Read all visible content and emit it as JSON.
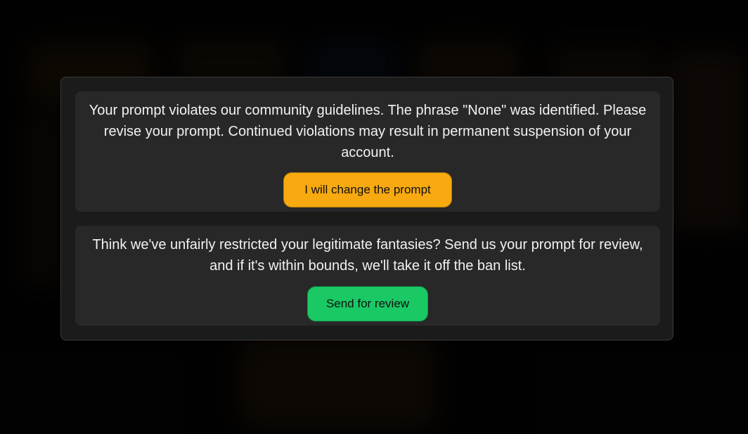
{
  "warning": {
    "message": "Your prompt violates our community guidelines. The phrase \"None\" was identified. Please revise your prompt. Continued violations may result in permanent suspension of your account.",
    "button_label": "I will change the prompt",
    "button_color": "#f7a90f"
  },
  "review": {
    "message": "Think we've unfairly restricted your legitimate fantasies? Send us your prompt for review, and if it's within bounds, we'll take it off the ban list.",
    "button_label": "Send for review",
    "button_color": "#1ac964"
  }
}
